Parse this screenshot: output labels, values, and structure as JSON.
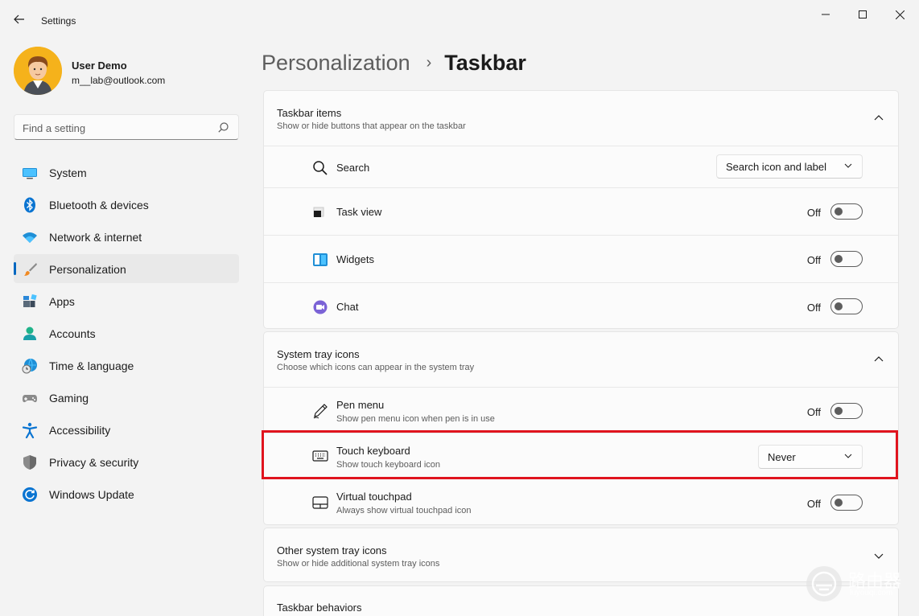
{
  "window": {
    "title": "Settings",
    "controls": [
      "minimize-icon",
      "maximize-icon",
      "close-icon"
    ]
  },
  "profile": {
    "name": "User Demo",
    "email": "m__lab@outlook.com"
  },
  "search": {
    "placeholder": "Find a setting"
  },
  "sidebar": {
    "items": [
      {
        "label": "System",
        "icon": "system-icon"
      },
      {
        "label": "Bluetooth & devices",
        "icon": "bluetooth-icon"
      },
      {
        "label": "Network & internet",
        "icon": "wifi-icon"
      },
      {
        "label": "Personalization",
        "icon": "brush-icon",
        "active": true
      },
      {
        "label": "Apps",
        "icon": "apps-icon"
      },
      {
        "label": "Accounts",
        "icon": "accounts-icon"
      },
      {
        "label": "Time & language",
        "icon": "globe-clock-icon"
      },
      {
        "label": "Gaming",
        "icon": "gamepad-icon"
      },
      {
        "label": "Accessibility",
        "icon": "accessibility-icon"
      },
      {
        "label": "Privacy & security",
        "icon": "shield-icon"
      },
      {
        "label": "Windows Update",
        "icon": "update-icon"
      }
    ]
  },
  "breadcrumb": {
    "parent": "Personalization",
    "separator": "›",
    "current": "Taskbar"
  },
  "taskbar_items": {
    "title": "Taskbar items",
    "subtitle": "Show or hide buttons that appear on the taskbar",
    "rows": [
      {
        "label": "Search",
        "control": "dropdown",
        "value": "Search icon and label"
      },
      {
        "label": "Task view",
        "control": "toggle",
        "state": "Off"
      },
      {
        "label": "Widgets",
        "control": "toggle",
        "state": "Off"
      },
      {
        "label": "Chat",
        "control": "toggle",
        "state": "Off"
      }
    ]
  },
  "system_tray": {
    "title": "System tray icons",
    "subtitle": "Choose which icons can appear in the system tray",
    "rows": [
      {
        "label": "Pen menu",
        "sub": "Show pen menu icon when pen is in use",
        "control": "toggle",
        "state": "Off"
      },
      {
        "label": "Touch keyboard",
        "sub": "Show touch keyboard icon",
        "control": "dropdown",
        "value": "Never"
      },
      {
        "label": "Virtual touchpad",
        "sub": "Always show virtual touchpad icon",
        "control": "toggle",
        "state": "Off"
      }
    ]
  },
  "other_tray": {
    "title": "Other system tray icons",
    "subtitle": "Show or hide additional system tray icons"
  },
  "taskbar_behaviors": {
    "title": "Taskbar behaviors"
  },
  "watermark": {
    "main": "路由器",
    "sub": "luyouqi.com"
  },
  "colors": {
    "accent": "#0067c0",
    "highlight": "#e0141e",
    "background": "#f3f3f3",
    "card": "#fbfbfb"
  }
}
